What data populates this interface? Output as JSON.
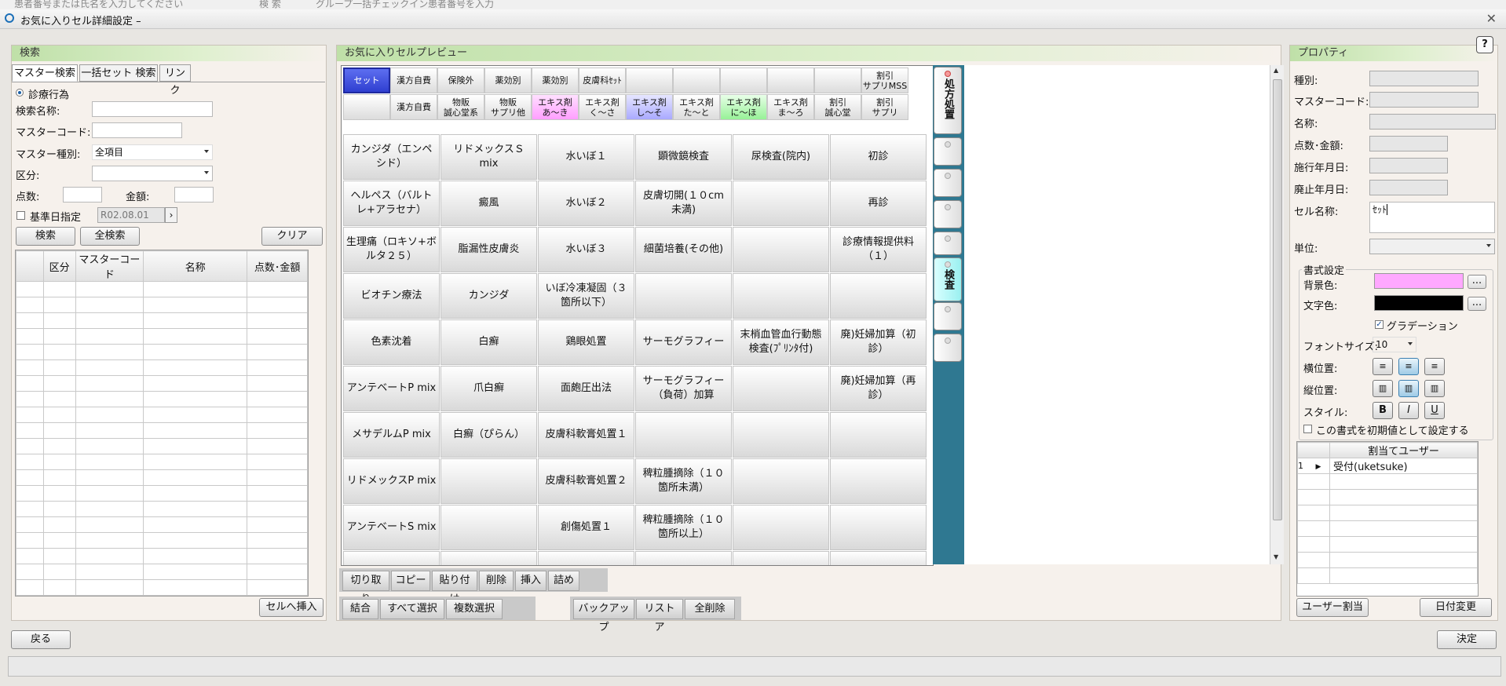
{
  "top_strip": {
    "search_placeholder": "患者番号または氏名を入力してください",
    "btn1": "検 索",
    "btn2": "グループ一括チェックイン",
    "hint": "患者番号を入力"
  },
  "window": {
    "title": "お気に入りセル詳細設定  –",
    "close": "✕"
  },
  "search_panel": {
    "header": "検索",
    "tabs": [
      "マスター検索",
      "一括セット 検索",
      "リンク"
    ],
    "radio_label": "診療行為",
    "fields": {
      "search_name": "検索名称:",
      "master_code": "マスターコード:",
      "master_type": "マスター種別:",
      "master_type_value": "全項目",
      "category": "区分:",
      "points": "点数:",
      "amount": "金額:",
      "base_date_label": "基準日指定",
      "base_date_value": "R02.08.01"
    },
    "buttons": {
      "search": "検索",
      "search_all": "全検索",
      "clear": "クリア",
      "insert": "セルへ挿入"
    },
    "table_headers": [
      "区分",
      "マスターコード",
      "名称",
      "点数･金額"
    ]
  },
  "preview_panel": {
    "header": "お気に入りセルプレビュー",
    "tab_row1": [
      "セット",
      "漢方自費",
      "保険外",
      "薬効別",
      "薬効別",
      "皮膚科ｾｯﾄ",
      "",
      "",
      "",
      "",
      "",
      "割引\nサプリMSS"
    ],
    "tab_row2": [
      "",
      "漢方自費",
      "物販\n誠心堂系",
      "物販\nサプリ他",
      "エキス剤\nあ～き",
      "エキス剤\nく～さ",
      "エキス剤\nし～そ",
      "エキス剤\nた～と",
      "エキス剤\nに～ほ",
      "エキス剤\nま～ろ",
      "割引\n誠心堂",
      "割引\nサプリ"
    ],
    "cells": [
      [
        "カンジダ（エンペシド）",
        "リドメックスＳ mix",
        "水いぼ１",
        "顕微鏡検査",
        "尿検査(院内)",
        "初診"
      ],
      [
        "ヘルペス（バルトレ+アラセナ）",
        "癜風",
        "水いぼ２",
        "皮膚切開(１０cm未満)",
        "",
        "再診"
      ],
      [
        "生理痛（ロキソ+ボルタ２５）",
        "脂漏性皮膚炎",
        "水いぼ３",
        "細菌培養(その他)",
        "",
        "診療情報提供料（１）"
      ],
      [
        "ビオチン療法",
        "カンジダ",
        "いぼ冷凍凝固（３箇所以下）",
        "",
        "",
        ""
      ],
      [
        "色素沈着",
        "白癬",
        "鶏眼処置",
        "サーモグラフィー",
        "末梢血管血行動態検査(ﾌﾟﾘﾝﾀ付)",
        "廃)妊婦加算（初診）"
      ],
      [
        "アンテベートP mix",
        "爪白癬",
        "面皰圧出法",
        "サーモグラフィー（負荷）加算",
        "",
        "廃)妊婦加算（再診）"
      ],
      [
        "メサデルムP mix",
        "白癬（ぴらん）",
        "皮膚科軟膏処置１",
        "",
        "",
        ""
      ],
      [
        "リドメックスP mix",
        "",
        "皮膚科軟膏処置２",
        "稗粒腫摘除（１０箇所未満）",
        "",
        ""
      ],
      [
        "アンテベートS mix",
        "",
        "創傷処置１",
        "稗粒腫摘除（１０箇所以上）",
        "",
        ""
      ]
    ],
    "side_tabs": [
      "処方処置",
      "",
      "",
      "",
      "",
      "検査",
      "",
      ""
    ],
    "toolbar1": [
      "切り取り",
      "コピー",
      "貼り付け",
      "削除",
      "挿入",
      "詰め"
    ],
    "toolbar2": [
      "結合",
      "すべて選択",
      "複数選択"
    ],
    "toolbar3": [
      "バックアップ",
      "リストア",
      "全削除"
    ]
  },
  "property_panel": {
    "header": "プロパティ",
    "help": "?",
    "labels": {
      "type": "種別:",
      "master_code": "マスターコード:",
      "name": "名称:",
      "points_amount": "点数･金額:",
      "start_date": "施行年月日:",
      "end_date": "廃止年月日:",
      "cell_name": "セル名称:",
      "unit": "単位:"
    },
    "cell_name_value": "ｾｯﾄ",
    "format": {
      "title": "書式設定",
      "bg_label": "背景色:",
      "fg_label": "文字色:",
      "bg_color": "#ffa8ff",
      "fg_color": "#000000",
      "gradient_label": "グラデーション",
      "font_size_label": "フォントサイズ:",
      "font_size_value": "10",
      "h_align_label": "横位置:",
      "v_align_label": "縦位置:",
      "style_label": "スタイル:",
      "style_buttons": [
        "B",
        "I",
        "U"
      ],
      "default_check_label": "この書式を初期値として設定する",
      "more": "..."
    },
    "user_table": {
      "header": "割当てユーザー",
      "rows": [
        {
          "no": "1",
          "user": "受付(uketsuke)"
        }
      ]
    },
    "buttons": {
      "assign_user": "ユーザー割当",
      "date_change": "日付変更"
    }
  },
  "bottom": {
    "back": "戻る",
    "ok": "決定"
  }
}
